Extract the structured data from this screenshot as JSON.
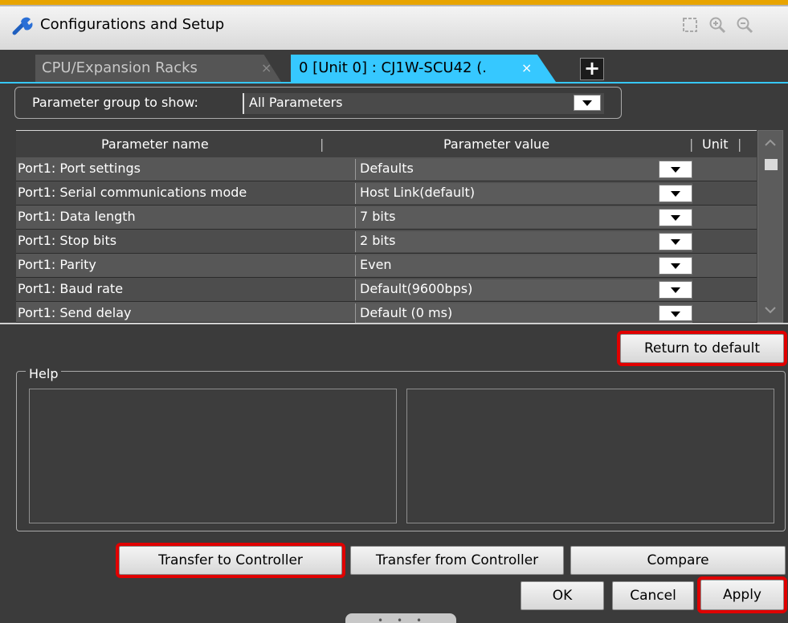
{
  "window": {
    "title": "Configurations and Setup",
    "icons": [
      "wrench-icon",
      "fit-icon",
      "zoom-in-icon",
      "zoom-out-icon"
    ]
  },
  "tabs": [
    {
      "label": "CPU/Expansion Racks",
      "close": "×",
      "active": false
    },
    {
      "label": "0 [Unit 0] : CJ1W-SCU42 (.",
      "close": "×",
      "active": true
    }
  ],
  "tab_add": "+",
  "parameter_group": {
    "label": "Parameter group to show:",
    "value": "All Parameters"
  },
  "table": {
    "headers": {
      "name": "Parameter name",
      "value": "Parameter value",
      "unit": "Unit"
    },
    "separator": "|",
    "rows": [
      {
        "name": "Port1: Port settings",
        "value": "Defaults"
      },
      {
        "name": "Port1: Serial communications mode",
        "value": "Host Link(default)"
      },
      {
        "name": "Port1: Data length",
        "value": "7 bits"
      },
      {
        "name": "Port1: Stop bits",
        "value": "2 bits"
      },
      {
        "name": "Port1: Parity",
        "value": "Even"
      },
      {
        "name": "Port1: Baud rate",
        "value": "Default(9600bps)"
      },
      {
        "name": "Port1: Send delay",
        "value": "Default (0 ms)"
      }
    ]
  },
  "buttons": {
    "return_default": "Return to default",
    "transfer_to": "Transfer to Controller",
    "transfer_from": "Transfer from Controller",
    "compare": "Compare",
    "ok": "OK",
    "cancel": "Cancel",
    "apply": "Apply"
  },
  "help": {
    "label": "Help"
  },
  "colors": {
    "accent": "#36c8ff",
    "highlight": "#e00000",
    "title_accent": "#e8a400"
  }
}
